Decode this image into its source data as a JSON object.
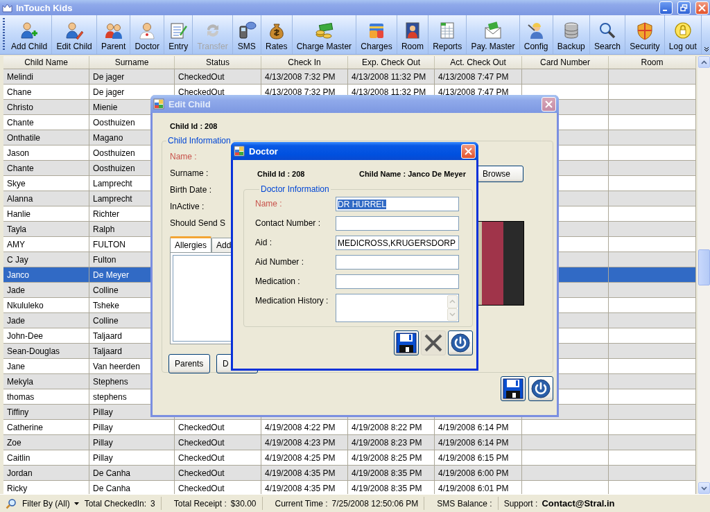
{
  "window": {
    "title": "InTouch Kids",
    "active": false
  },
  "toolbar": [
    {
      "label": "Add Child",
      "disabled": false
    },
    {
      "label": "Edit Child",
      "disabled": false
    },
    {
      "label": "Parent",
      "disabled": false
    },
    {
      "label": "Doctor",
      "disabled": false
    },
    {
      "label": "Entry",
      "disabled": false
    },
    {
      "label": "Transfer",
      "disabled": true
    },
    {
      "label": "SMS",
      "disabled": false
    },
    {
      "label": "Rates",
      "disabled": false
    },
    {
      "label": "Charge Master",
      "disabled": false
    },
    {
      "label": "Charges",
      "disabled": false
    },
    {
      "label": "Room",
      "disabled": false
    },
    {
      "label": "Reports",
      "disabled": false
    },
    {
      "label": "Pay. Master",
      "disabled": false
    },
    {
      "label": "Config",
      "disabled": false
    },
    {
      "label": "Backup",
      "disabled": false
    },
    {
      "label": "Search",
      "disabled": false
    },
    {
      "label": "Security",
      "disabled": false
    },
    {
      "label": "Log out",
      "disabled": false
    }
  ],
  "table": {
    "columns": [
      "Child Name",
      "Surname",
      "Status",
      "Check In",
      "Exp. Check Out",
      "Act. Check Out",
      "Card Number",
      "Room"
    ],
    "rows": [
      {
        "cells": [
          "Melindi",
          "De jager",
          "CheckedOut",
          "4/13/2008 7:32 PM",
          "4/13/2008 11:32 PM",
          "4/13/2008 7:47 PM"
        ],
        "selected": false
      },
      {
        "cells": [
          "Chane",
          "De jager",
          "CheckedOut",
          "4/13/2008 7:32 PM",
          "4/13/2008 11:32 PM",
          "4/13/2008 7:47 PM"
        ],
        "selected": false
      },
      {
        "cells": [
          "Christo",
          "Mienie"
        ],
        "selected": false
      },
      {
        "cells": [
          "Chante",
          "Oosthuizen"
        ],
        "selected": false
      },
      {
        "cells": [
          "Onthatile",
          "Magano"
        ],
        "selected": false
      },
      {
        "cells": [
          "Jason",
          "Oosthuizen"
        ],
        "selected": false
      },
      {
        "cells": [
          "Chante",
          "Oosthuizen"
        ],
        "selected": false
      },
      {
        "cells": [
          "Skye",
          "Lamprecht"
        ],
        "selected": false
      },
      {
        "cells": [
          "Alanna",
          "Lamprecht"
        ],
        "selected": false
      },
      {
        "cells": [
          "Hanlie",
          "Richter"
        ],
        "selected": false
      },
      {
        "cells": [
          "Tayla",
          "Ralph"
        ],
        "selected": false
      },
      {
        "cells": [
          "AMY",
          "FULTON"
        ],
        "selected": false
      },
      {
        "cells": [
          "C Jay",
          "Fulton"
        ],
        "selected": false
      },
      {
        "cells": [
          "Janco",
          "De Meyer"
        ],
        "selected": true
      },
      {
        "cells": [
          "Jade",
          "Colline"
        ],
        "selected": false
      },
      {
        "cells": [
          "Nkululeko",
          "Tsheke"
        ],
        "selected": false
      },
      {
        "cells": [
          "Jade",
          "Colline"
        ],
        "selected": false
      },
      {
        "cells": [
          "John-Dee",
          "Taljaard"
        ],
        "selected": false
      },
      {
        "cells": [
          "Sean-Douglas",
          "Taljaard"
        ],
        "selected": false
      },
      {
        "cells": [
          "Jane",
          "Van heerden"
        ],
        "selected": false
      },
      {
        "cells": [
          "Mekyla",
          "Stephens"
        ],
        "selected": false
      },
      {
        "cells": [
          "thomas",
          "stephens"
        ],
        "selected": false
      },
      {
        "cells": [
          "Tiffiny",
          "Pillay"
        ],
        "selected": false
      },
      {
        "cells": [
          "Catherine",
          "Pillay",
          "CheckedOut",
          "4/19/2008 4:22 PM",
          "4/19/2008 8:22 PM",
          "4/19/2008 6:14 PM"
        ],
        "selected": false
      },
      {
        "cells": [
          "Zoe",
          "Pillay",
          "CheckedOut",
          "4/19/2008 4:23 PM",
          "4/19/2008 8:23 PM",
          "4/19/2008 6:14 PM"
        ],
        "selected": false
      },
      {
        "cells": [
          "Caitlin",
          "Pillay",
          "CheckedOut",
          "4/19/2008 4:25 PM",
          "4/19/2008 8:25 PM",
          "4/19/2008 6:15 PM"
        ],
        "selected": false
      },
      {
        "cells": [
          "Jordan",
          "De Canha",
          "CheckedOut",
          "4/19/2008 4:35 PM",
          "4/19/2008 8:35 PM",
          "4/19/2008 6:00 PM"
        ],
        "selected": false
      },
      {
        "cells": [
          "Ricky",
          "De Canha",
          "CheckedOut",
          "4/19/2008 4:35 PM",
          "4/19/2008 8:35 PM",
          "4/19/2008 6:01 PM"
        ],
        "selected": false
      }
    ]
  },
  "edit_child_dialog": {
    "title": "Edit Child",
    "active": false,
    "child_id": "Child Id : 208",
    "group_title": "Child Information",
    "fields": [
      {
        "label": "Name :",
        "required": true
      },
      {
        "label": "Surname :",
        "required": false
      },
      {
        "label": "Birth Date :",
        "required": false
      },
      {
        "label": "InActive :",
        "required": false
      },
      {
        "label": "Should Send S",
        "required": false
      }
    ],
    "tabs": [
      {
        "label": "Allergies",
        "selected": true
      },
      {
        "label": "Add",
        "selected": false
      }
    ],
    "buttons": [
      "Parents",
      "D"
    ],
    "browse_button": "Browse",
    "actions": [
      {
        "kind": "save",
        "disabled": false
      },
      {
        "kind": "close",
        "disabled": false
      }
    ]
  },
  "doctor_dialog": {
    "title": "Doctor",
    "active": true,
    "child_id": "Child Id : 208",
    "child_name": "Child Name : Janco De Meyer",
    "group_title": "Doctor Information",
    "fields": [
      {
        "label": "Name :",
        "required": true,
        "kind": "text",
        "value": "DR HURREL",
        "text_selected": true
      },
      {
        "label": "Contact Number :",
        "required": false,
        "kind": "text"
      },
      {
        "label": "Aid :",
        "required": false,
        "kind": "text",
        "value": "MEDICROSS,KRUGERSDORP",
        "text_selected": false
      },
      {
        "label": "Aid Number :",
        "required": false,
        "kind": "text"
      },
      {
        "label": "Medication :",
        "required": false,
        "kind": "text"
      },
      {
        "label": "Medication History :",
        "required": false,
        "kind": "multiline"
      }
    ],
    "actions": [
      {
        "kind": "save",
        "disabled": false
      },
      {
        "kind": "cancel",
        "disabled": true
      },
      {
        "kind": "close",
        "disabled": false
      }
    ]
  },
  "status_bar": {
    "filter": "Filter By (All)",
    "items": [
      {
        "label": "Total CheckedIn:",
        "value": "3",
        "kind": "figure"
      },
      {
        "label": "Total Receipt :",
        "value": "$30.00",
        "kind": "figure"
      },
      {
        "label": "Current Time :",
        "value": "7/25/2008 12:50:06 PM",
        "kind": "figure"
      },
      {
        "label": "SMS Balance :"
      },
      {
        "label": "Support :",
        "value": "Contact@Stral.in",
        "kind": "contact"
      }
    ]
  }
}
